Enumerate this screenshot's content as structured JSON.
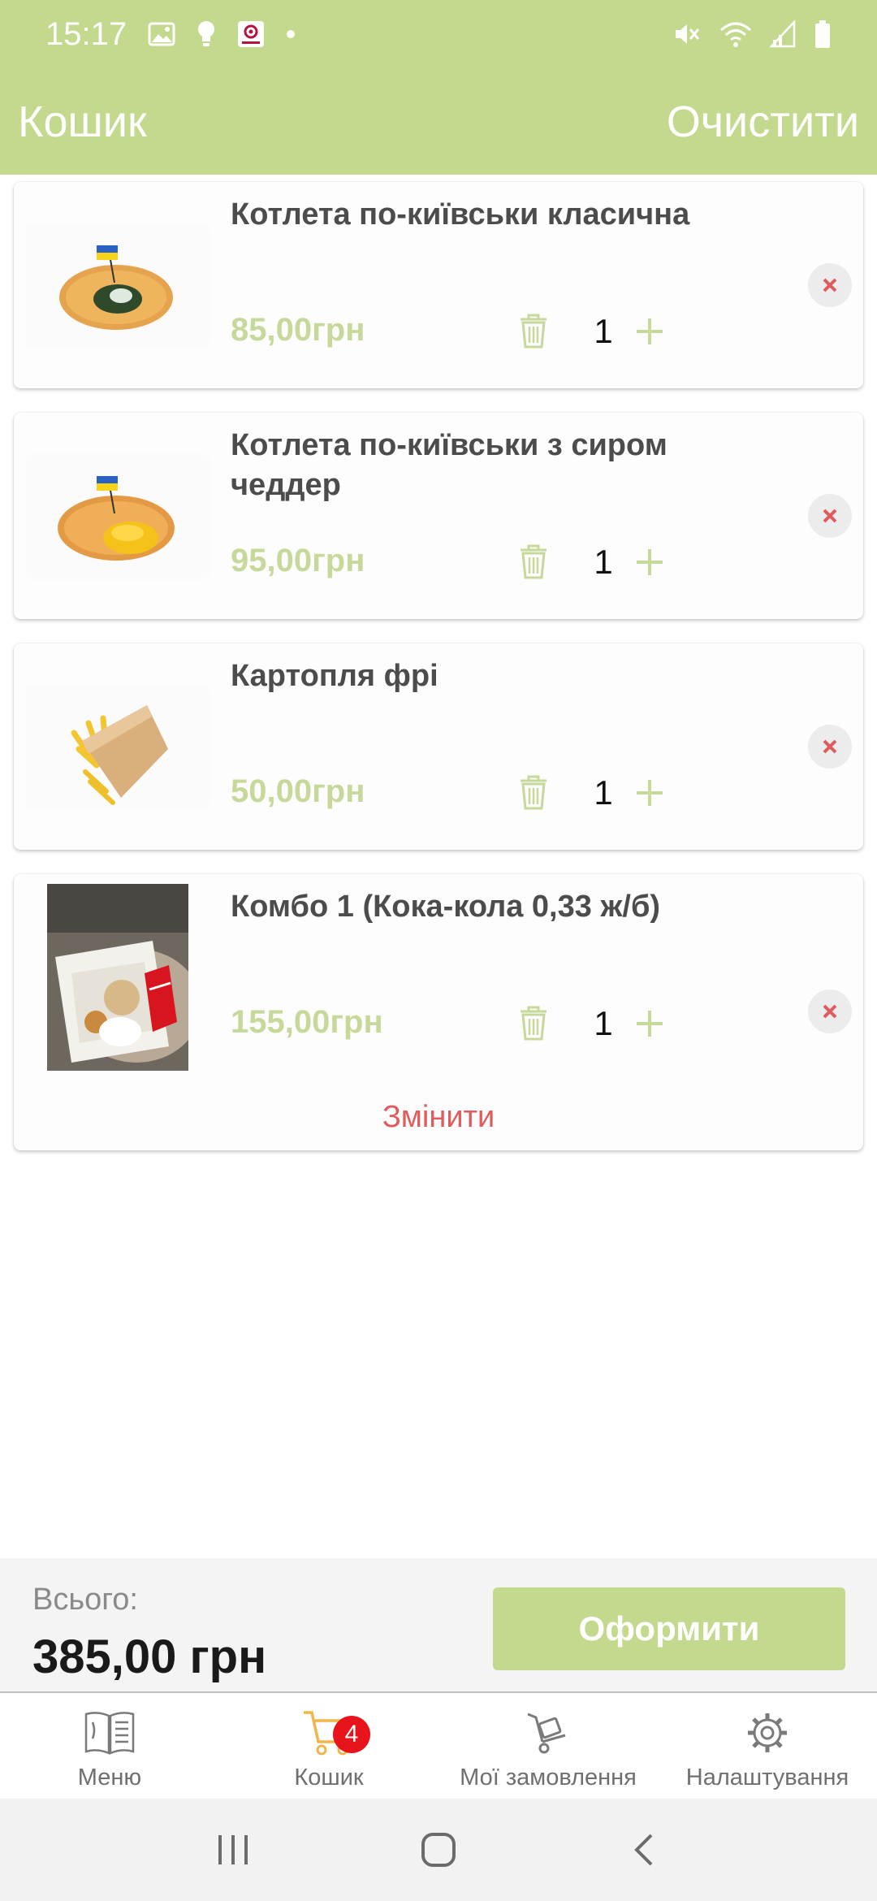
{
  "status_bar": {
    "time": "15:17",
    "left_icons": [
      "image-icon",
      "bulb-icon",
      "app-notification-icon",
      "dot-icon"
    ],
    "right_icons": [
      "mute-icon",
      "wifi-icon",
      "signal-icon",
      "battery-icon"
    ]
  },
  "header": {
    "title": "Кошик",
    "clear_label": "Очистити",
    "background_color": "#c3d98d"
  },
  "cart": {
    "items": [
      {
        "name": "Котлета по-київськи класична",
        "price": "85,00грн",
        "quantity": "1",
        "image": "chicken-kiev-spinach-image",
        "flag": "ukraine-flag"
      },
      {
        "name": "Котлета по-київськи з сиром чеддер",
        "price": "95,00грн",
        "quantity": "1",
        "image": "chicken-kiev-cheddar-image",
        "flag": "ukraine-flag"
      },
      {
        "name": "Картопля фрі",
        "price": "50,00грн",
        "quantity": "1",
        "image": "french-fries-image"
      },
      {
        "name": "Комбо 1  (Кока-кола 0,33 ж/б)",
        "price": "155,00грн",
        "quantity": "1",
        "image": "combo-box-photo",
        "change_label": "Змінити"
      }
    ],
    "price_color": "#c6d99a",
    "remove_color": "#e05b5b"
  },
  "footer": {
    "total_label": "Всього:",
    "total_value": "385,00 грн",
    "checkout_label": "Оформити"
  },
  "tabbar": {
    "tabs": [
      {
        "label": "Меню",
        "icon": "menu-book-icon"
      },
      {
        "label": "Кошик",
        "icon": "cart-icon",
        "badge": "4",
        "active": true
      },
      {
        "label": "Мої замовлення",
        "icon": "orders-cart-icon"
      },
      {
        "label": "Налаштування",
        "icon": "gear-icon"
      }
    ]
  },
  "system_nav": [
    "recents-icon",
    "home-icon",
    "back-icon"
  ]
}
